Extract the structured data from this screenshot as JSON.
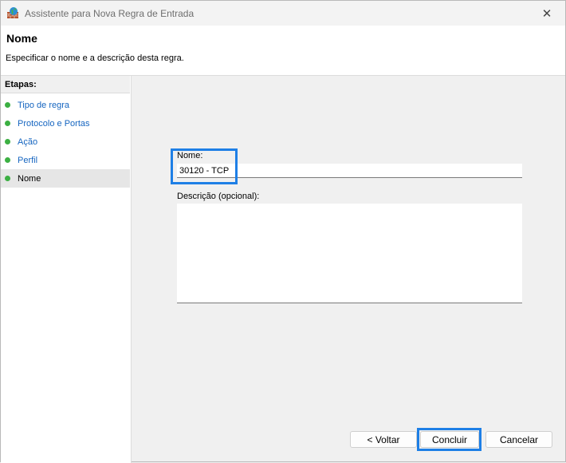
{
  "window": {
    "title": "Assistente para Nova Regra de Entrada",
    "close_glyph": "✕"
  },
  "header": {
    "title": "Nome",
    "description": "Especificar o nome e a descrição desta regra."
  },
  "sidebar": {
    "heading": "Etapas:",
    "steps": [
      {
        "label": "Tipo de regra"
      },
      {
        "label": "Protocolo e Portas"
      },
      {
        "label": "Ação"
      },
      {
        "label": "Perfil"
      },
      {
        "label": "Nome"
      }
    ],
    "current_step": "Nome"
  },
  "form": {
    "name_label": "Nome:",
    "name_value": "30120 - TCP",
    "description_label": "Descrição (opcional):",
    "description_value": ""
  },
  "buttons": {
    "back": "< Voltar",
    "finish": "Concluir",
    "cancel": "Cancelar"
  },
  "colors": {
    "accent_highlight": "#1e7fe6",
    "step_dot": "#3cb043",
    "step_link": "#1565c0"
  },
  "icons": {
    "app": "firewall-icon",
    "close": "close-icon",
    "step": "green-dot-icon"
  }
}
